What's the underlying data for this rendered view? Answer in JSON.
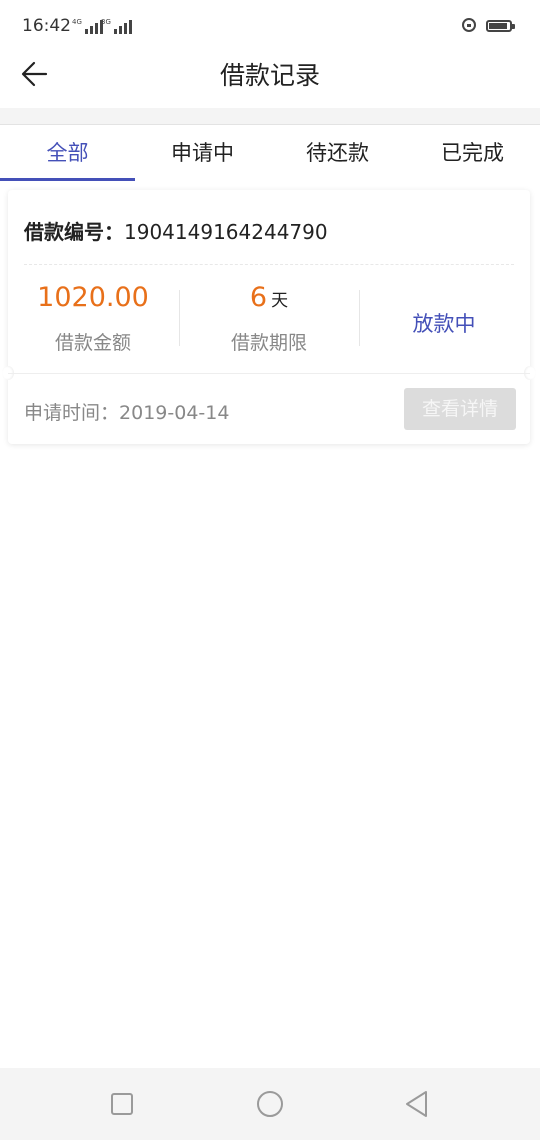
{
  "status_bar": {
    "time": "16:42",
    "signal_1_tag": "4G",
    "signal_2_tag": "3G",
    "icons": [
      "signal-icon",
      "signal-icon",
      "lock-rotation-icon",
      "battery-icon"
    ]
  },
  "header": {
    "title": "借款记录",
    "back_icon": "arrow-left-icon"
  },
  "tabs": [
    {
      "label": "全部",
      "active": true
    },
    {
      "label": "申请中",
      "active": false
    },
    {
      "label": "待还款",
      "active": false
    },
    {
      "label": "已完成",
      "active": false
    }
  ],
  "loan_card": {
    "loan_no_label": "借款编号：",
    "loan_no": "1904149164244790",
    "amount": "1020.00",
    "amount_label": "借款金额",
    "term": "6",
    "term_unit": "天",
    "term_label": "借款期限",
    "status": "放款中",
    "apply_time_label": "申请时间：",
    "apply_time": "2019-04-14",
    "detail_button": "查看详情"
  },
  "nav_bar": {
    "icons": [
      "square-recent-icon",
      "circle-home-icon",
      "triangle-back-icon"
    ]
  },
  "colors": {
    "accent": "#4450b8",
    "amount": "#e8701a",
    "muted": "#888888"
  }
}
